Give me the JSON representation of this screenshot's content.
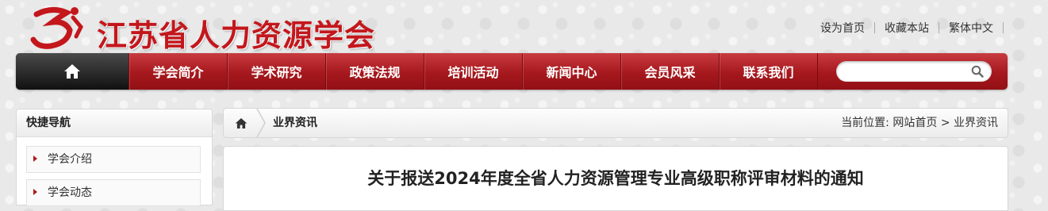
{
  "header": {
    "site_title": "江苏省人力资源学会",
    "top_links": [
      "设为首页",
      "收藏本站",
      "繁体中文"
    ]
  },
  "nav": {
    "home_icon": "home-icon",
    "items": [
      "学会简介",
      "学术研究",
      "政策法规",
      "培训活动",
      "新闻中心",
      "会员风采",
      "联系我们"
    ],
    "search_placeholder": "",
    "search_icon": "search-icon"
  },
  "sidebar": {
    "title": "快捷导航",
    "items": [
      "学会介绍",
      "学会动态"
    ]
  },
  "breadcrumb": {
    "section": "业界资讯",
    "current_label": "当前位置:",
    "home_link": "网站首页",
    "separator": ">",
    "current": "业界资讯"
  },
  "article": {
    "title": "关于报送2024年度全省人力资源管理专业高级职称评审材料的通知"
  },
  "colors": {
    "brand_red": "#b01a1f",
    "nav_dark": "#1a1a1a"
  }
}
